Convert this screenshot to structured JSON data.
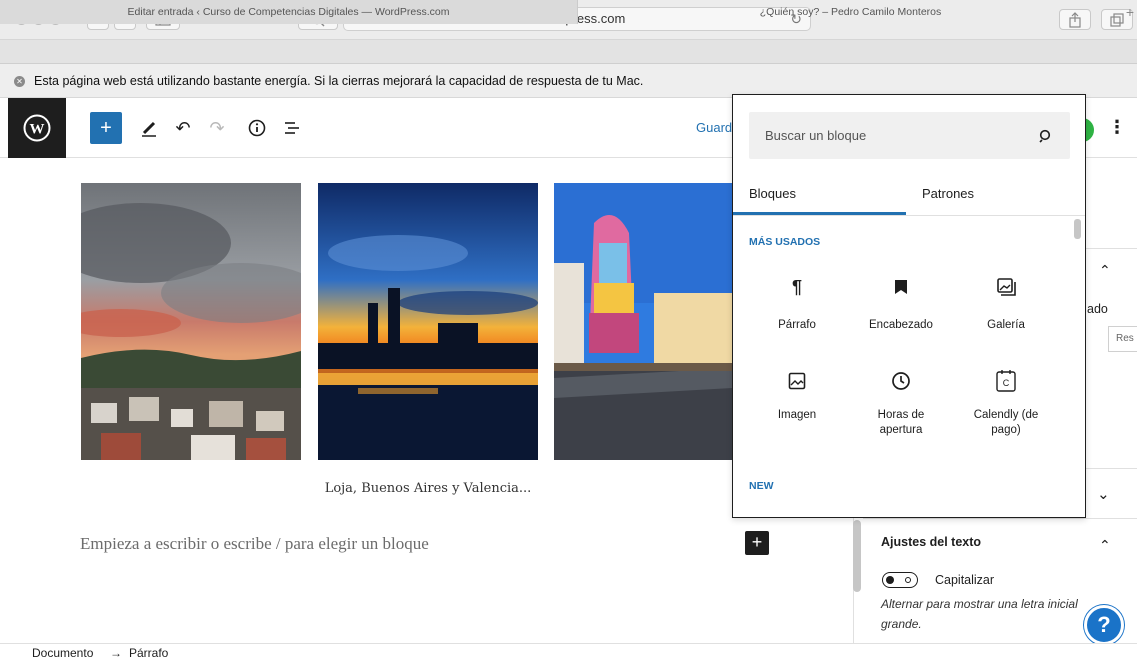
{
  "browser": {
    "address": "wordpress.com",
    "tabs": [
      {
        "label": "Editar entrada ‹ Curso de Competencias Digitales — WordPress.com"
      },
      {
        "label": "¿Quién soy? – Pedro Camilo Monteros"
      }
    ],
    "new_tab": "+"
  },
  "energy_warning": {
    "text": "Esta página web está utilizando bastante energía. Si la cierras mejorará la capacidad de respuesta de tu Mac."
  },
  "editor": {
    "save_label": "Guardar",
    "add_block": "+",
    "gallery_caption": "Loja, Buenos Aires y Valencia...",
    "placeholder": "Empieza a escribir o escribe / para elegir un bloque",
    "inline_add": "+"
  },
  "inserter": {
    "search_placeholder": "Buscar un bloque",
    "tabs": [
      {
        "label": "Bloques"
      },
      {
        "label": "Patrones"
      }
    ],
    "section_title": "MÁS USADOS",
    "blocks": [
      {
        "label": "Párrafo",
        "icon": "paragraph-icon"
      },
      {
        "label": "Encabezado",
        "icon": "bookmark-icon"
      },
      {
        "label": "Galería",
        "icon": "gallery-icon"
      },
      {
        "label": "Imagen",
        "icon": "image-icon"
      },
      {
        "label": "Horas de apertura",
        "icon": "clock-icon"
      },
      {
        "label": "Calendly (de pago)",
        "icon": "calendly-icon"
      }
    ],
    "next_section": "NEW"
  },
  "sidebar": {
    "partial_text": "ado",
    "partial_button": "Res",
    "text_settings_title": "Ajustes del texto",
    "toggle_label": "Capitalizar",
    "help_text": "Alternar para mostrar una letra inicial grande."
  },
  "footer": {
    "crumb_document": "Documento",
    "crumb_arrow": "→",
    "crumb_block": "Párrafo"
  },
  "colors": {
    "accent": "#2271b1",
    "dark": "#1e1e1e",
    "help": "#1a73c8"
  }
}
